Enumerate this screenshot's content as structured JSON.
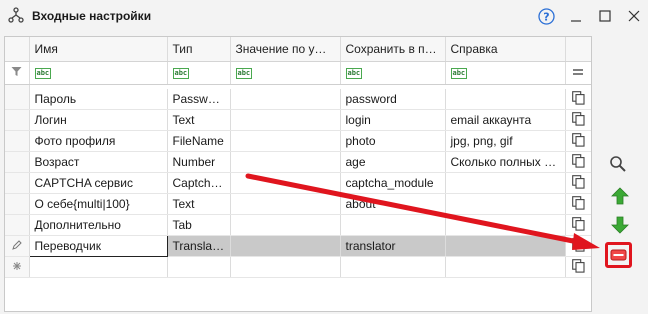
{
  "window": {
    "title": "Входные настройки"
  },
  "columns": [
    "Имя",
    "Тип",
    "Значение по умо...",
    "Сохранить в пе...",
    "Справка"
  ],
  "filter": {
    "abc_label": "abc"
  },
  "rows": [
    {
      "name": "Пароль",
      "type": "Password",
      "value": "",
      "save_to": "password",
      "help": ""
    },
    {
      "name": "Логин",
      "type": "Text",
      "value": "",
      "save_to": "login",
      "help": "email аккаунта"
    },
    {
      "name": "Фото профиля",
      "type": "FileName",
      "value": "",
      "save_to": "photo",
      "help": "jpg, png, gif"
    },
    {
      "name": "Возраст",
      "type": "Number",
      "value": "",
      "save_to": "age",
      "help": "Сколько полных лет"
    },
    {
      "name": "CAPTCHA сервис",
      "type": "Captcha...",
      "value": "",
      "save_to": "captcha_module",
      "help": ""
    },
    {
      "name": "О себе{multi|100}",
      "type": "Text",
      "value": "",
      "save_to": "about",
      "help": ""
    },
    {
      "name": "Дополнительно",
      "type": "Tab",
      "value": "",
      "save_to": "",
      "help": ""
    },
    {
      "name": "Переводчик",
      "type": "Translat...",
      "value": "",
      "save_to": "translator",
      "help": ""
    }
  ],
  "colors": {
    "arrow": "#e0151e",
    "up": "#3ba935",
    "down": "#3ba935"
  }
}
